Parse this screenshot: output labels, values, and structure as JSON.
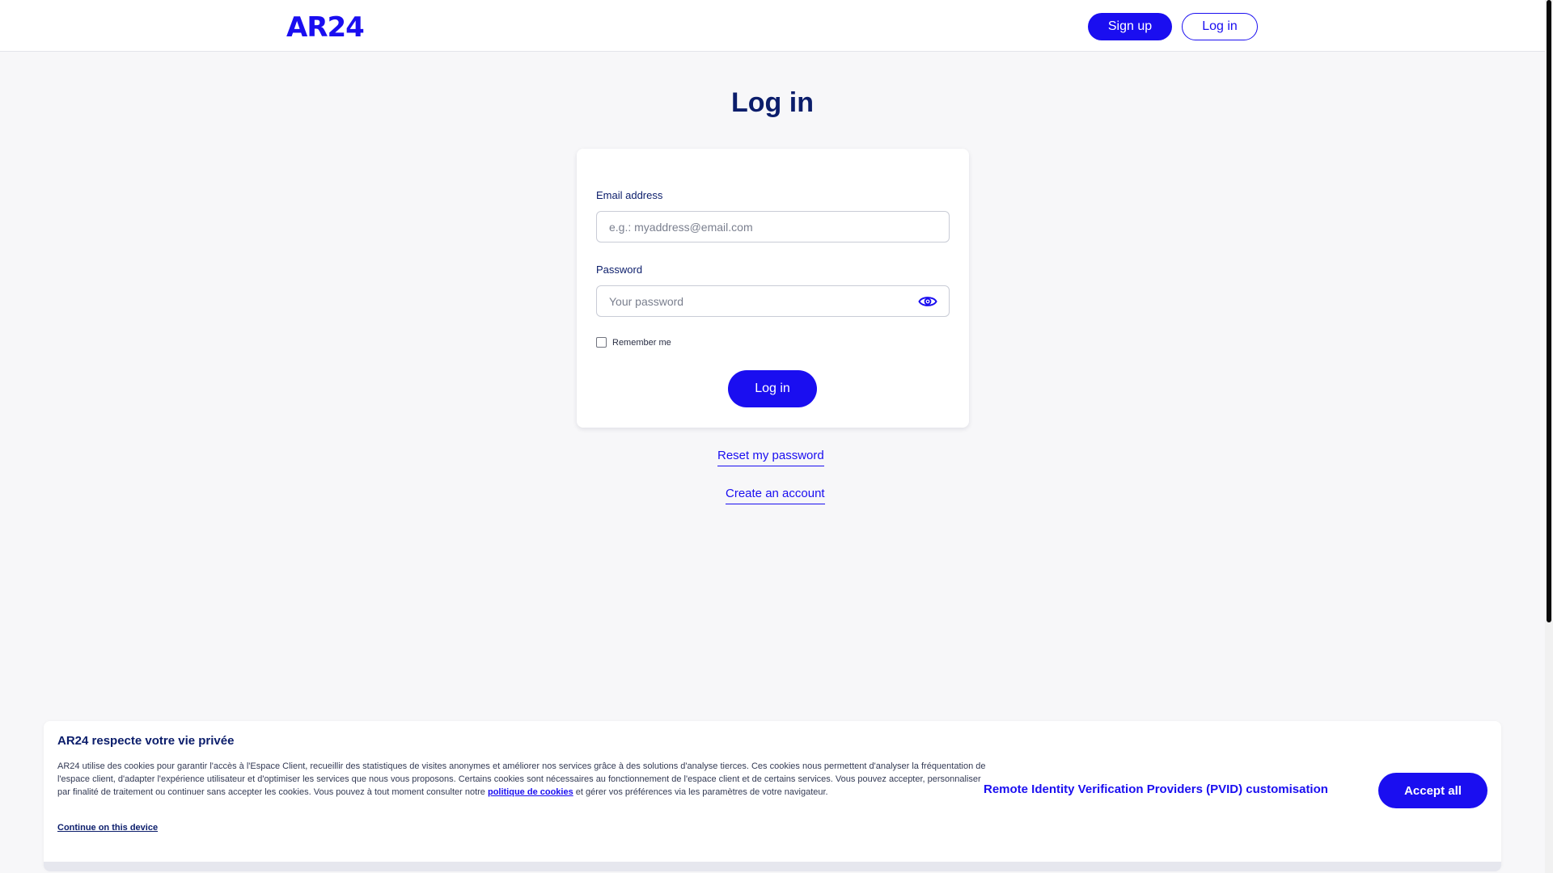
{
  "header": {
    "logo": "AR24",
    "signup_label": "Sign up",
    "login_label": "Log in"
  },
  "page": {
    "title": "Log in"
  },
  "form": {
    "email_label": "Email address",
    "email_placeholder": "e.g.: myaddress@email.com",
    "password_label": "Password",
    "password_placeholder": "Your password",
    "remember_label": "Remember me",
    "remember_checked": false,
    "submit_label": "Log in"
  },
  "links": {
    "reset_password": "Reset my password",
    "create_account": "Create an account"
  },
  "cookie_banner": {
    "title": "AR24 respecte votre vie privée",
    "text_before_link": "AR24 utilise des cookies pour garantir l'accès à l'Espace Client, recueillir des statistiques de visites anonymes et améliorer nos services grâce à des solutions d'analyse tierces. Ces cookies nous permettent d'analyser la fréquentation de l'espace client, d'adapter l'expérience utilisateur et d'optimiser les services que nous vous proposons. Certains cookies sont nécessaires au fonctionnement de l'espace client et de certains services. Vous pouvez accepter, personnaliser par finalité de traitement ou continuer sans accepter les cookies. Vous pouvez à tout moment consulter notre ",
    "link_text": "politique de cookies",
    "text_after_link": " et gérer vos préférences via les paramètres de votre navigateur.",
    "continue_label": "Continue on this device",
    "pvid_label": "Remote Identity Verification Providers (PVID) customisation",
    "accept_label": "Accept all"
  },
  "colors": {
    "brand": "#1a0ef0",
    "text_dark": "#0b1d6b",
    "background": "#f7f7f9"
  }
}
